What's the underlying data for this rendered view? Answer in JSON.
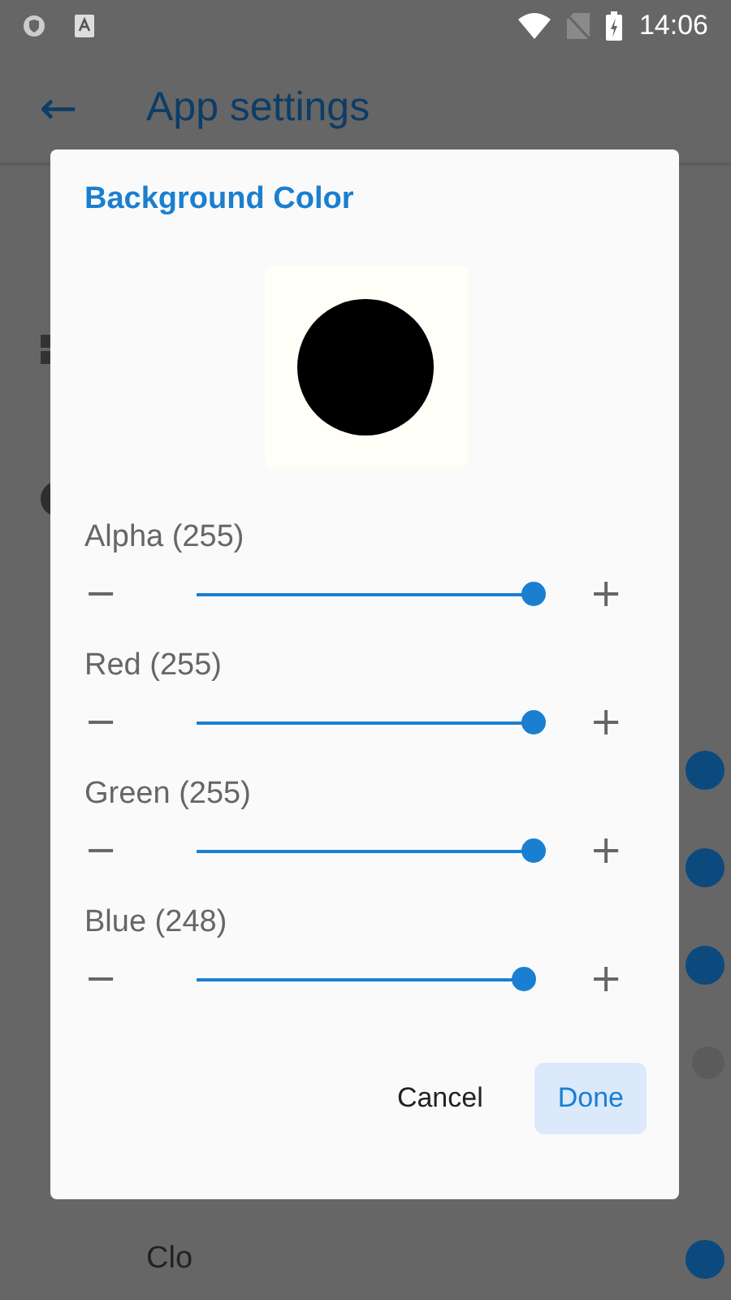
{
  "status_bar": {
    "time": "14:06"
  },
  "app_bar": {
    "back": "←",
    "title": "App settings"
  },
  "background_rows": [
    {
      "kind": "icon"
    },
    {
      "kind": "avatar"
    },
    {
      "kind": "toggle",
      "on": true
    },
    {
      "kind": "toggle",
      "on": true
    },
    {
      "kind": "toggle",
      "on": true
    },
    {
      "kind": "toggle",
      "on": false
    },
    {
      "kind": "toggle",
      "on": true,
      "label": "Clo"
    }
  ],
  "dialog": {
    "title": "Background Color",
    "preview": {
      "color": "#fffff8"
    },
    "channels": [
      {
        "label": "Alpha (255)",
        "minus": "−",
        "plus": "+",
        "level": 1
      },
      {
        "label": "Red (255)",
        "minus": "−",
        "plus": "+",
        "level": 1
      },
      {
        "label": "Green (255)",
        "minus": "−",
        "plus": "+",
        "level": 1
      },
      {
        "label": "Blue (248)",
        "minus": "−",
        "plus": "+",
        "level": 0.973
      }
    ],
    "buttons": [
      {
        "label": "Cancel",
        "kind": "text"
      },
      {
        "label": "Done",
        "kind": "filled"
      }
    ]
  }
}
